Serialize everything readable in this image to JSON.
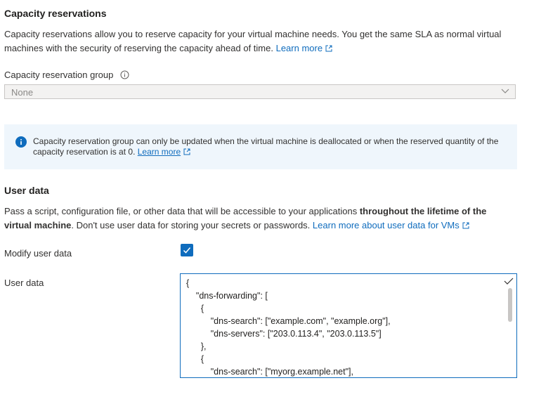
{
  "capacity": {
    "heading": "Capacity reservations",
    "desc_line1": "Capacity reservations allow you to reserve capacity for your virtual machine needs. You get the same SLA as normal virtual",
    "desc_line2": "machines with the security of reserving the capacity ahead of time.",
    "learn_more": "Learn more",
    "group_label": "Capacity reservation group",
    "group_value": "None",
    "info_line1": "Capacity reservation group can only be updated when the virtual machine is deallocated or when the reserved quantity of the",
    "info_line2": "capacity reservation is at 0.",
    "info_learn_more": "Learn more"
  },
  "userdata": {
    "heading": "User data",
    "desc_part1": "Pass a script, configuration file, or other data that will be accessible to your applications ",
    "desc_bold1": "throughout the lifetime of the",
    "desc_bold2": "virtual machine",
    "desc_part2": ". Don't use user data for storing your secrets or passwords.",
    "learn_more": "Learn more about user data for VMs",
    "modify_label": "Modify user data",
    "modify_checked": true,
    "field_label": "User data",
    "content": "{\n    \"dns-forwarding\": [\n      {\n          \"dns-search\": [\"example.com\", \"example.org\"],\n          \"dns-servers\": [\"203.0.113.4\", \"203.0.113.5\"]\n      },\n      {\n          \"dns-search\": [\"myorg.example.net\"],"
  },
  "icons": [
    "info-circle-icon",
    "chevron-down-icon",
    "info-filled-icon",
    "external-link-icon",
    "checkmark-icon",
    "valid-check-icon"
  ],
  "colors": {
    "link": "#0f6cbd",
    "info_bg": "#eff6fc",
    "checkbox": "#0f6cbd"
  }
}
